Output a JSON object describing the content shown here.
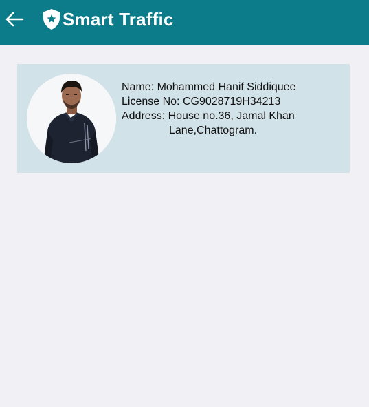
{
  "app_bar": {
    "title": "Smart Traffic",
    "back_icon": "arrow-left-icon",
    "logo_icon": "shield-star-icon",
    "color": "#0d7c8a"
  },
  "profile": {
    "name_label": "Name:",
    "name_value": "Mohammed Hanif Siddiquee",
    "license_label": "License No:",
    "license_value": "CG9028719H34213",
    "address_label": "Address:",
    "address_line1": "House no.36, Jamal Khan",
    "address_line2": "Lane,Chattogram.",
    "card_color": "#d2e2e9"
  }
}
